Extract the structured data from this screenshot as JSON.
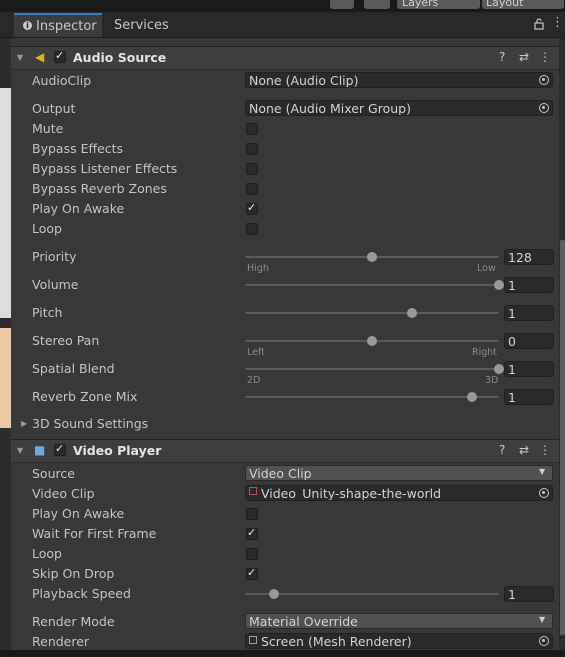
{
  "top_bar": {
    "layers": "Layers",
    "layout": "Layout"
  },
  "tabs": {
    "inspector": "Inspector",
    "services": "Services"
  },
  "audio_source": {
    "title": "Audio Source",
    "audioclip_label": "AudioClip",
    "audioclip_value": "None (Audio Clip)",
    "output_label": "Output",
    "output_value": "None (Audio Mixer Group)",
    "mute_label": "Mute",
    "mute": false,
    "bypass_effects_label": "Bypass Effects",
    "bypass_effects": false,
    "bypass_listener_label": "Bypass Listener Effects",
    "bypass_listener": false,
    "bypass_reverb_label": "Bypass Reverb Zones",
    "bypass_reverb": false,
    "play_on_awake_label": "Play On Awake",
    "play_on_awake": true,
    "loop_label": "Loop",
    "loop": false,
    "priority_label": "Priority",
    "priority_value": "128",
    "priority_low": "High",
    "priority_high": "Low",
    "volume_label": "Volume",
    "volume_value": "1",
    "pitch_label": "Pitch",
    "pitch_value": "1",
    "stereo_pan_label": "Stereo Pan",
    "stereo_pan_value": "0",
    "stereo_pan_low": "Left",
    "stereo_pan_high": "Right",
    "spatial_blend_label": "Spatial Blend",
    "spatial_blend_value": "1",
    "spatial_low": "2D",
    "spatial_high": "3D",
    "reverb_mix_label": "Reverb Zone Mix",
    "reverb_mix_value": "1",
    "sound_settings_label": "3D Sound Settings"
  },
  "video_player": {
    "title": "Video Player",
    "source_label": "Source",
    "source_value": "Video Clip",
    "video_clip_label": "Video Clip",
    "video_clip_value": "Video_Unity-shape-the-world",
    "play_on_awake_label": "Play On Awake",
    "play_on_awake": false,
    "wait_first_frame_label": "Wait For First Frame",
    "wait_first_frame": true,
    "loop_label": "Loop",
    "loop": false,
    "skip_on_drop_label": "Skip On Drop",
    "skip_on_drop": true,
    "playback_speed_label": "Playback Speed",
    "playback_speed_value": "1",
    "render_mode_label": "Render Mode",
    "render_mode_value": "Material Override",
    "renderer_label": "Renderer",
    "renderer_value": "Screen (Mesh Renderer)"
  },
  "slider_levels": {
    "priority": 0.5,
    "volume": 1.0,
    "pitch": 0.657,
    "stereo_pan": 0.5,
    "spatial_blend": 1.0,
    "reverb_mix": 0.892,
    "playback_speed": 0.114
  },
  "colors": {
    "accent": "#3a79bb",
    "background": "#383838",
    "field": "#2a2a2a"
  }
}
